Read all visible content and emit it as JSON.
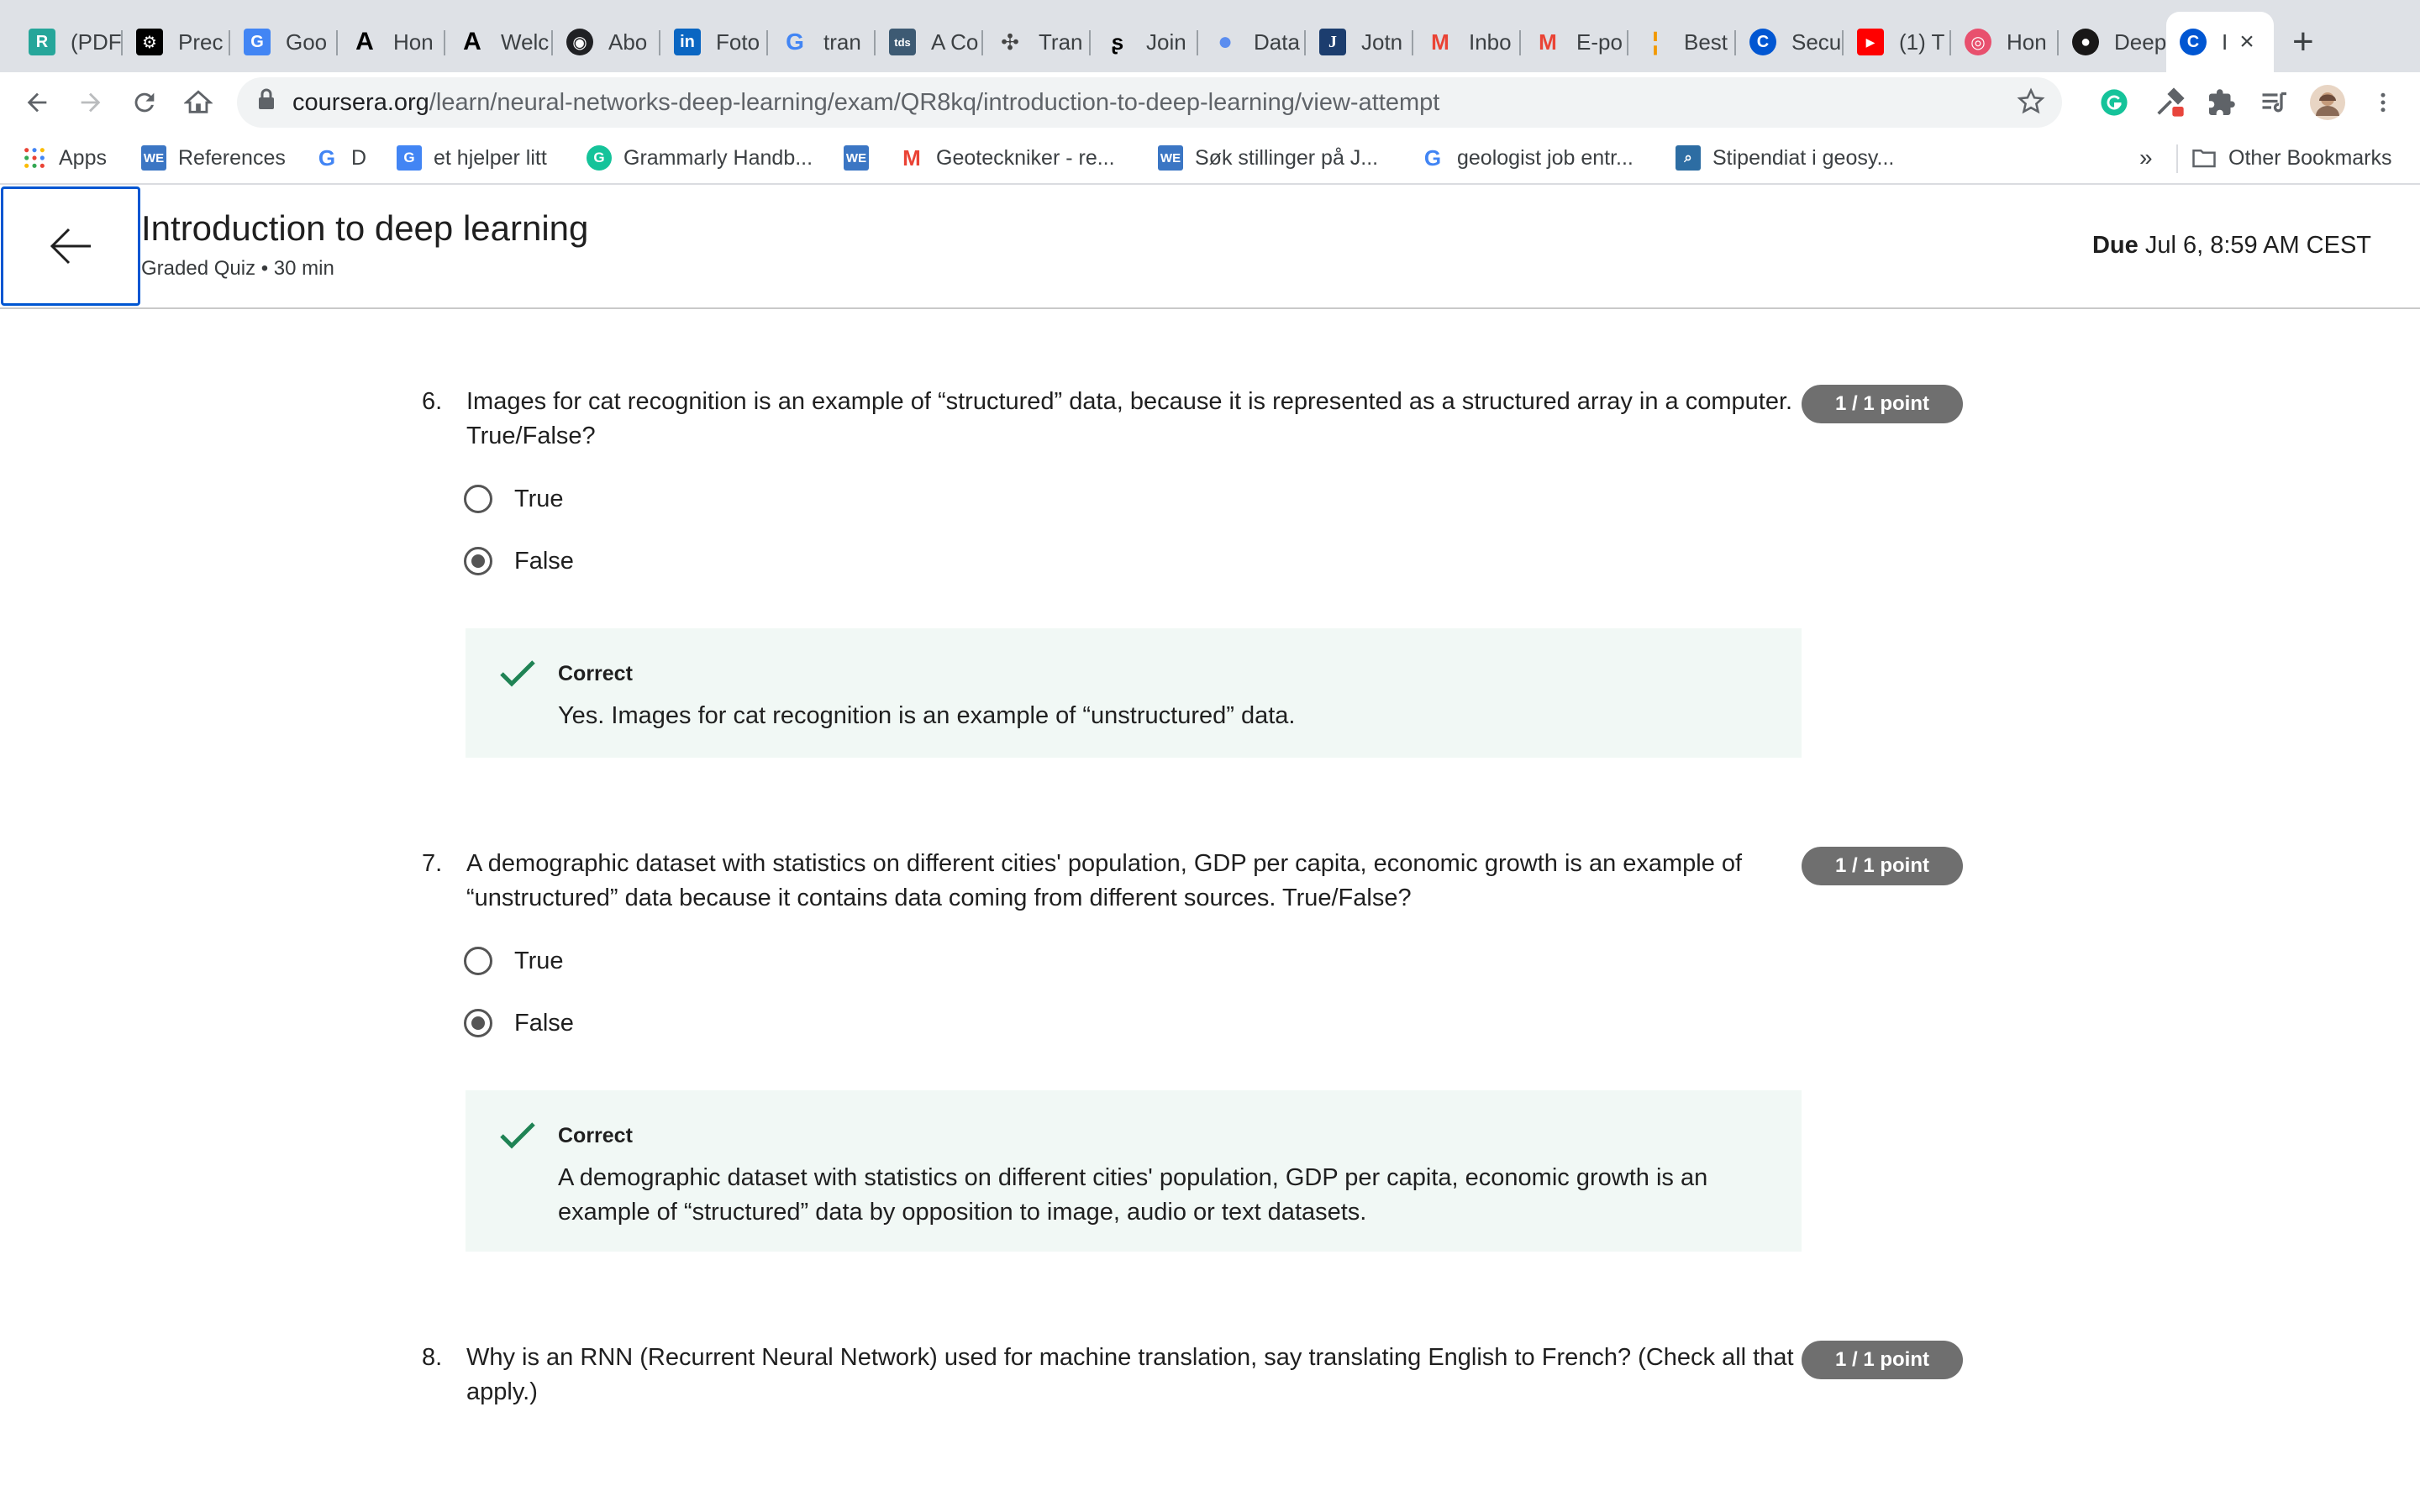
{
  "browser": {
    "tabs": [
      {
        "label": "(PDF",
        "fav_text": "R",
        "fav_color": "#26a69a"
      },
      {
        "label": "Prec",
        "fav_text": "⚙",
        "fav_color": "#000000"
      },
      {
        "label": "Goo",
        "fav_text": "G",
        "fav_color": "#4285f4"
      },
      {
        "label": "Hon",
        "fav_text": "A",
        "fav_color": "#ffffff"
      },
      {
        "label": "Welc",
        "fav_text": "A",
        "fav_color": "#ffffff"
      },
      {
        "label": "Abo",
        "fav_text": "◉",
        "fav_color": "#202124"
      },
      {
        "label": "Foto",
        "fav_text": "in",
        "fav_color": "#0a66c2"
      },
      {
        "label": "tran",
        "fav_text": "G",
        "fav_color": "#ffffff"
      },
      {
        "label": "A Co",
        "fav_text": "tds",
        "fav_color": "#3d5a73"
      },
      {
        "label": "Tran",
        "fav_text": "✣",
        "fav_color": "#ffffff"
      },
      {
        "label": "Join",
        "fav_text": "ʂ",
        "fav_color": "#ffffff"
      },
      {
        "label": "Data",
        "fav_text": "●",
        "fav_color": "#5b8def"
      },
      {
        "label": "Jotn",
        "fav_text": "J",
        "fav_color": "#1c3d6e"
      },
      {
        "label": "Inbo",
        "fav_text": "M",
        "fav_color": "#ffffff"
      },
      {
        "label": "E-po",
        "fav_text": "M",
        "fav_color": "#ffffff"
      },
      {
        "label": "Best",
        "fav_text": "¦",
        "fav_color": "#ffffff"
      },
      {
        "label": "Secu",
        "fav_text": "C",
        "fav_color": "#0056d2"
      },
      {
        "label": "(1) T",
        "fav_text": "▶",
        "fav_color": "#ff0000"
      },
      {
        "label": "Hon",
        "fav_text": "◎",
        "fav_color": "#e8506e"
      },
      {
        "label": "Deep",
        "fav_text": "●",
        "fav_color": "#181717"
      },
      {
        "label": "I",
        "fav_text": "C",
        "fav_color": "#0056d2"
      }
    ],
    "url_host": "coursera.org",
    "url_path": "/learn/neural-networks-deep-learning/exam/QR8kq/introduction-to-deep-learning/view-attempt",
    "bookmarks": [
      {
        "label": "Apps",
        "fav_text": "⋮⋮",
        "fav_color": "#ffffff"
      },
      {
        "label": "References",
        "fav_text": "WE",
        "fav_color": "#3b76c4"
      },
      {
        "label": "D",
        "fav_text": "G",
        "fav_color": "#ffffff"
      },
      {
        "label": "et hjelper litt",
        "fav_text": "G",
        "fav_color": "#4285f4"
      },
      {
        "label": "Grammarly Handb...",
        "fav_text": "G",
        "fav_color": "#15c39a"
      },
      {
        "label": "",
        "fav_text": "WE",
        "fav_color": "#3b76c4"
      },
      {
        "label": "Geoteckniker - re...",
        "fav_text": "M",
        "fav_color": "#ffffff"
      },
      {
        "label": "Søk stillinger på J...",
        "fav_text": "WE",
        "fav_color": "#3b76c4"
      },
      {
        "label": "geologist job entr...",
        "fav_text": "G",
        "fav_color": "#ffffff"
      },
      {
        "label": "Stipendiat i geosy...",
        "fav_text": "⌕",
        "fav_color": "#2d6da3"
      }
    ],
    "more_bookmarks": "»",
    "other_bookmarks": "Other Bookmarks"
  },
  "header": {
    "title": "Introduction to deep learning",
    "subtitle": "Graded Quiz • 30 min",
    "due_label": "Due",
    "due_value": "Jul 6, 8:59 AM CEST"
  },
  "questions": [
    {
      "number": "6.",
      "text": "Images for cat recognition is an example of “structured” data, because it is represented as a structured array in a computer. True/False?",
      "points": "1 / 1 point",
      "options": [
        {
          "label": "True",
          "selected": false
        },
        {
          "label": "False",
          "selected": true
        }
      ],
      "feedback_label": "Correct",
      "feedback_text": "Yes. Images for cat recognition is an example of “unstructured” data."
    },
    {
      "number": "7.",
      "text": "A demographic dataset with statistics on different cities' population, GDP per capita, economic growth is an example of “unstructured” data because it contains data coming from different sources. True/False?",
      "points": "1 / 1 point",
      "options": [
        {
          "label": "True",
          "selected": false
        },
        {
          "label": "False",
          "selected": true
        }
      ],
      "feedback_label": "Correct",
      "feedback_text": "A demographic dataset with statistics on different cities' population, GDP per capita, economic growth is an example of “structured” data by opposition to image, audio or text datasets."
    },
    {
      "number": "8.",
      "text": "Why is an RNN (Recurrent Neural Network) used for machine translation, say translating English to French? (Check all that apply.)",
      "points": "1 / 1 point"
    }
  ],
  "colors": {
    "accent": "#0056d2",
    "correct_green": "#1f8354",
    "feedback_bg": "#f1f8f5",
    "badge_bg": "#6f6f6f"
  }
}
